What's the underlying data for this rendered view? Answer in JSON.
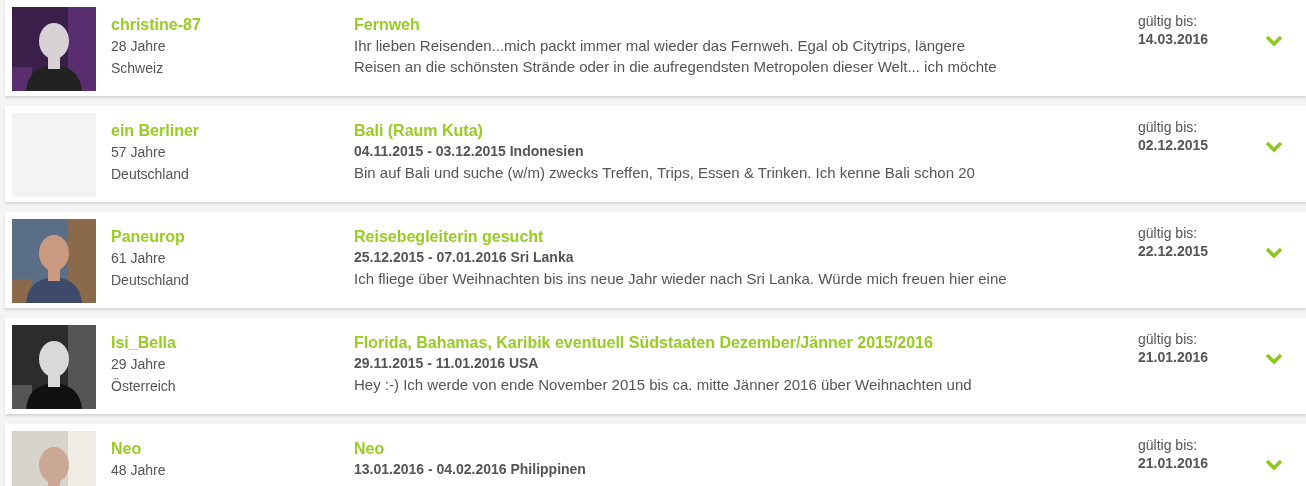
{
  "listings": [
    {
      "name": "christine-87",
      "age": "28 Jahre",
      "country": "Schweiz",
      "title": "Fernweh",
      "description": "Ihr lieben Reisenden...mich packt immer mal wieder das Fernweh. Egal ob Citytrips, längere\nReisen an die schönsten Strände oder in die aufregendsten Metropolen dieser Welt... ich möchte",
      "valid_label": "gültig bis:",
      "valid_date": "14.03.2016"
    },
    {
      "photo": {
        "kind": "blank"
      },
      "name": "ein Berliner",
      "age": "57 Jahre",
      "country": "Deutschland",
      "title": "Bali (Raum Kuta)",
      "dates": "04.11.2015 - 03.12.2015 Indonesien",
      "description": "Bin auf Bali und suche (w/m) zwecks Treffen, Trips, Essen & Trinken. Ich kenne Bali schon 20",
      "valid_label": "gültig bis:",
      "valid_date": "02.12.2015"
    },
    {
      "name": "Paneurop",
      "age": "61 Jahre",
      "country": "Deutschland",
      "title": "Reisebegleiterin gesucht",
      "dates": "25.12.2015 - 07.01.2016 Sri Lanka",
      "description": "Ich fliege über Weihnachten bis ins neue Jahr wieder nach Sri Lanka. Würde mich freuen hier eine",
      "valid_label": "gültig bis:",
      "valid_date": "22.12.2015"
    },
    {
      "name": "Isi_Bella",
      "age": "29 Jahre",
      "country": "Österreich",
      "title": "Florida, Bahamas, Karibik eventuell Südstaaten Dezember/Jänner 2015/2016",
      "dates": "29.11.2015 - 11.01.2016 USA",
      "description": "Hey :-) Ich werde von ende November 2015 bis ca. mitte Jänner 2016 über Weihnachten und",
      "valid_label": "gültig bis:",
      "valid_date": "21.01.2016"
    },
    {
      "name": "Neo",
      "age": "48 Jahre",
      "title": "Neo",
      "dates": "13.01.2016 - 04.02.2016 Philippinen",
      "valid_label": "gültig bis:",
      "valid_date": "21.01.2016"
    }
  ]
}
